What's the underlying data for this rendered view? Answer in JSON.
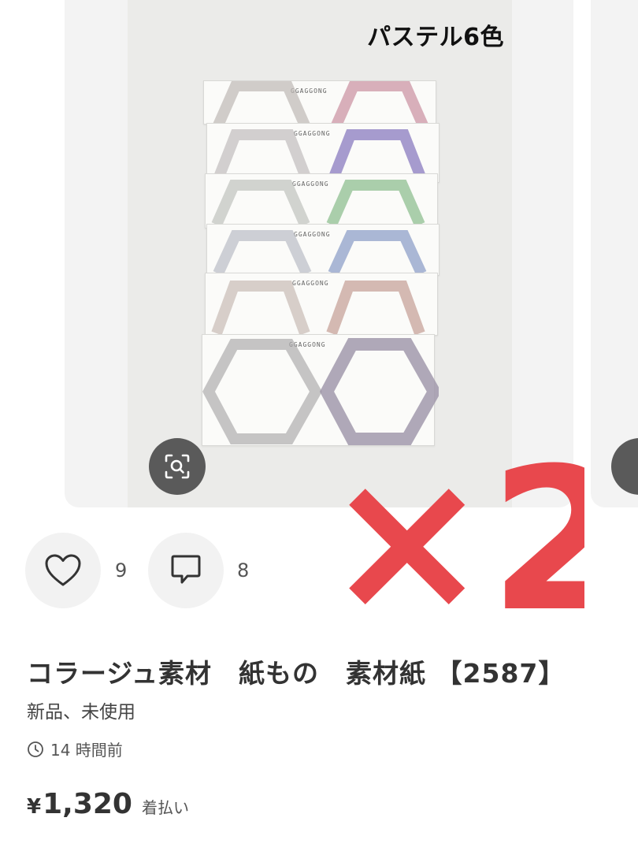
{
  "product": {
    "image_caption": "パステル6色",
    "sheet_brand": "GGAGGONG",
    "overlay_text": "×2",
    "title": "コラージュ素材　紙もの　素材紙 【2587】",
    "condition": "新品、未使用",
    "posted_time": "14 時間前",
    "currency": "¥",
    "price": "1,320",
    "shipping": "着払い"
  },
  "actions": {
    "like_count": "9",
    "comment_count": "8"
  },
  "colors": {
    "overlay": "#e8484d",
    "sheet_tints": [
      "#c98fa0",
      "#8a7bbf",
      "#8fbf90",
      "#8fa0c8",
      "#c7a39a",
      "#9c94a8"
    ]
  },
  "icons": [
    "zoom-icon",
    "heart-icon",
    "comment-icon",
    "clock-icon"
  ]
}
